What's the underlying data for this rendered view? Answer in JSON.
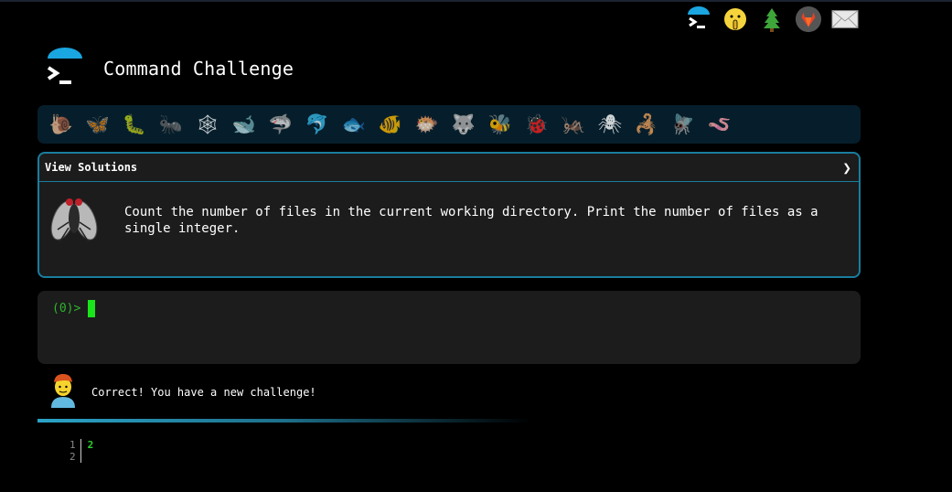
{
  "app": {
    "title": "Command Challenge"
  },
  "top_icons": [
    {
      "name": "terminal-logo-icon"
    },
    {
      "name": "shush-face-icon"
    },
    {
      "name": "tree-icon"
    },
    {
      "name": "gitlab-icon"
    },
    {
      "name": "envelope-icon"
    }
  ],
  "animals": [
    {
      "name": "snail-icon",
      "glyph": "🐌"
    },
    {
      "name": "butterfly-icon",
      "glyph": "🦋"
    },
    {
      "name": "caterpillar-icon",
      "glyph": "🐛"
    },
    {
      "name": "ant-icon",
      "glyph": "🐜"
    },
    {
      "name": "spider-web-icon",
      "glyph": "🕸"
    },
    {
      "name": "whale-icon",
      "glyph": "🐋"
    },
    {
      "name": "shark-icon",
      "glyph": "🦈"
    },
    {
      "name": "dolphin-icon",
      "glyph": "🐬"
    },
    {
      "name": "fish-icon",
      "glyph": "🐟"
    },
    {
      "name": "tropical-fish-icon",
      "glyph": "🐠"
    },
    {
      "name": "blowfish-icon",
      "glyph": "🐡"
    },
    {
      "name": "wolf-icon",
      "glyph": "🐺"
    },
    {
      "name": "bee-icon",
      "glyph": "🐝"
    },
    {
      "name": "ladybug-icon",
      "glyph": "🐞"
    },
    {
      "name": "cricket-icon",
      "glyph": "🦗"
    },
    {
      "name": "spider-icon",
      "glyph": "🕷"
    },
    {
      "name": "scorpion-icon",
      "glyph": "🦂"
    },
    {
      "name": "fly-icon",
      "glyph": "🪰"
    },
    {
      "name": "worm-icon",
      "glyph": "🪱"
    }
  ],
  "panel": {
    "solutions_label": "View Solutions",
    "chevron": "❯",
    "description": "Count the number of files in the current working directory. Print the number of files as a single integer."
  },
  "terminal": {
    "prompt": "(0)>"
  },
  "message": {
    "text": "Correct! You have a new challenge!"
  },
  "output": {
    "line_numbers": [
      "1",
      "2"
    ],
    "lines": [
      "2",
      ""
    ]
  },
  "colors": {
    "accent": "#1a7d9e",
    "prompt": "#2db52d",
    "cursor": "#19e51a",
    "panel_bg": "#1c1c1c",
    "strip_bg": "#061e2b"
  }
}
